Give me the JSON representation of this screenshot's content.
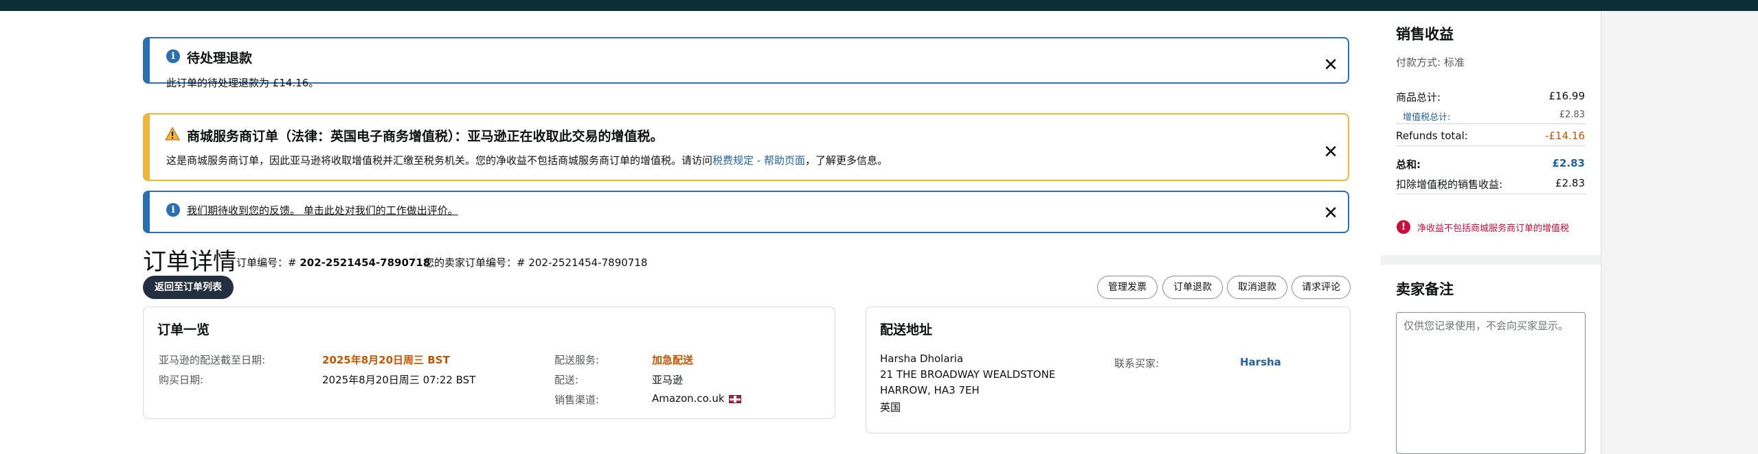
{
  "alerts": {
    "refund": {
      "title": "待处理退款",
      "body": "此订单的待处理退款为 £14.16。"
    },
    "vat": {
      "title": "商城服务商订单（法律：英国电子商务增值税）：亚马逊正在收取此交易的增值税。",
      "body_prefix": "这是商城服务商订单，因此亚马逊将收取增值税并汇缴至税务机关。您的净收益不包括商城服务商订单的增值税。请访问",
      "body_link": "税费规定 - 帮助页面",
      "body_suffix": "，了解更多信息。"
    },
    "feedback": {
      "link": "我们期待收到您的反馈。 单击此处对我们的工作做出评价。"
    },
    "close_glyph": "✕"
  },
  "order": {
    "heading": "订单详情",
    "order_id_label": "订单编号：# ",
    "order_id": "202-2521454-7890718",
    "seller_order_label": "您的卖家订单编号：# ",
    "seller_order_id": "202-2521454-7890718",
    "back_button": "返回至订单列表",
    "actions": [
      "管理发票",
      "订单退款",
      "取消退款",
      "请求评论"
    ]
  },
  "summary": {
    "title": "订单一览",
    "ship_by_label": "亚马逊的配送截至日期:",
    "ship_by_value": "2025年8月20日周三 BST",
    "purchase_date_label": "购买日期:",
    "purchase_date_value": "2025年8月20日周三 07:22 BST",
    "shipping_service_label": "配送服务:",
    "shipping_service_value": "加急配送",
    "fulfillment_label": "配送:",
    "fulfillment_value": "亚马逊",
    "channel_label": "销售渠道:",
    "channel_value": "Amazon.co.uk"
  },
  "address": {
    "title": "配送地址",
    "name": "Harsha Dholaria",
    "line1": "21 THE BROADWAY WEALDSTONE",
    "line2": "HARROW, HA3 7EH",
    "country": "英国",
    "contact_label": "联系买家:",
    "contact_name": "Harsha"
  },
  "revenue": {
    "title": "销售收益",
    "payment_method": "付款方式: 标准",
    "items_total_label": "商品总计:",
    "items_total_value": "£16.99",
    "vat_label": "增值税总计:",
    "vat_value": "£2.83",
    "refunds_label": "Refunds total:",
    "refunds_value": "-£14.16",
    "total_label": "总和:",
    "total_value": "£2.83",
    "net_label": "扣除增值税的销售收益:",
    "net_value": "£2.83",
    "notice": "净收益不包括商城服务商订单的增值税"
  },
  "notes": {
    "title": "卖家备注",
    "placeholder": "仅供您记录使用，不会向买家显示。"
  },
  "colors": {
    "info_blue": "#2a6fb0",
    "warning_amber": "#f0b63c",
    "accent_orange": "#c45500",
    "error_red": "#cc0c39",
    "topbar": "#0c2e36"
  }
}
